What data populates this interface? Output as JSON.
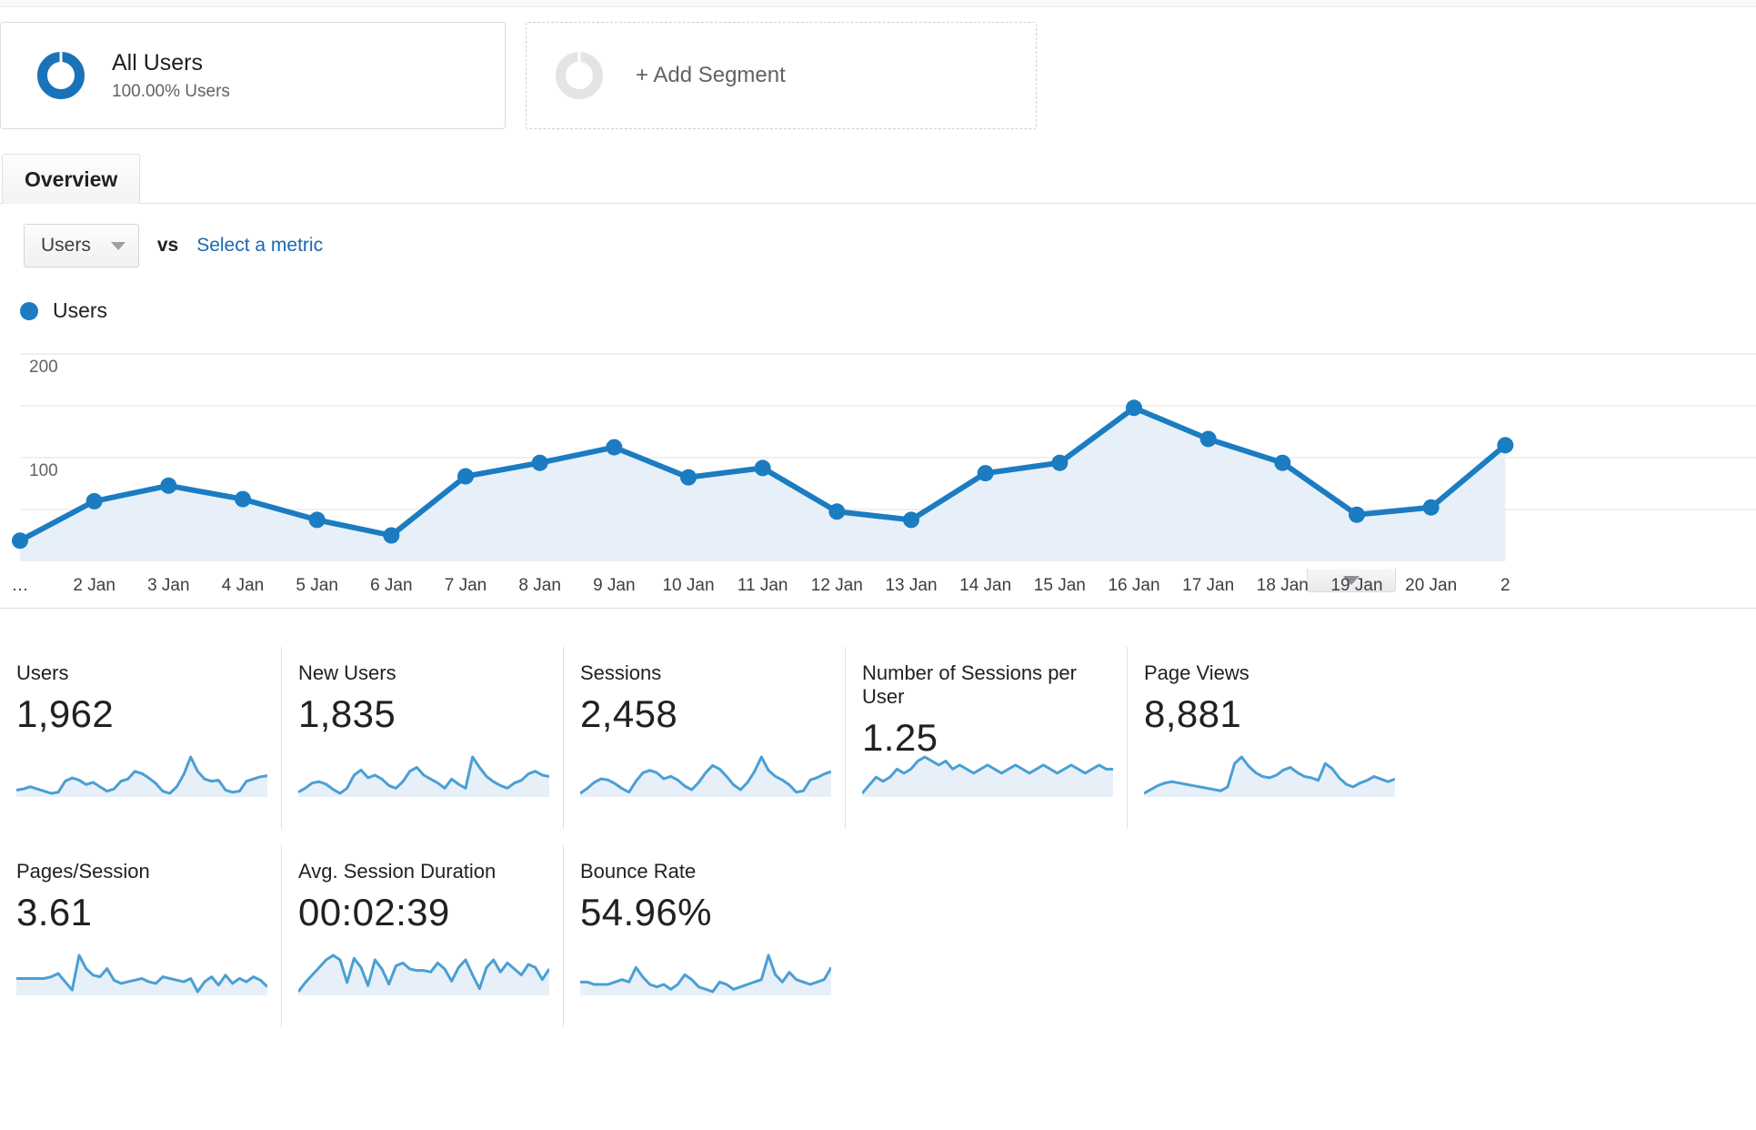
{
  "segment_bar": {
    "all_users": {
      "title": "All Users",
      "subtitle": "100.00% Users",
      "icon": "donut-icon"
    },
    "add_segment": {
      "label": "+ Add Segment",
      "icon": "donut-placeholder-icon"
    }
  },
  "tabs": [
    {
      "label": "Overview",
      "active": true
    }
  ],
  "metric_selector": {
    "selected_metric": "Users",
    "vs_label": "vs",
    "select_metric_link": "Select a metric",
    "caret_icon": "chevron-down-icon"
  },
  "legend": [
    {
      "label": "Users",
      "color": "#1b7cc1"
    }
  ],
  "chart_controls": {
    "collapse_icon": "chevron-down-icon"
  },
  "chart_data": {
    "type": "area",
    "title": "Users",
    "xlabel": "",
    "ylabel": "Users",
    "ylim": [
      0,
      200
    ],
    "yticks": [
      100,
      200
    ],
    "ytick_labels": [
      "100",
      "200"
    ],
    "gridlines": [
      50,
      100,
      150,
      200
    ],
    "grid": true,
    "legend_position": "top-left",
    "line_color": "#1b7cc1",
    "fill_color": "#e7f0f8",
    "marker": "circle",
    "categories": [
      "…",
      "2 Jan",
      "3 Jan",
      "4 Jan",
      "5 Jan",
      "6 Jan",
      "7 Jan",
      "8 Jan",
      "9 Jan",
      "10 Jan",
      "11 Jan",
      "12 Jan",
      "13 Jan",
      "14 Jan",
      "15 Jan",
      "16 Jan",
      "17 Jan",
      "18 Jan",
      "19 Jan",
      "20 Jan",
      "2"
    ],
    "series": [
      {
        "name": "Users",
        "values": [
          20,
          58,
          73,
          60,
          40,
          25,
          82,
          95,
          110,
          81,
          90,
          48,
          40,
          85,
          95,
          148,
          118,
          95,
          45,
          52,
          112
        ]
      }
    ]
  },
  "metric_cards_row1": [
    {
      "title": "Users",
      "value": "1,962",
      "spark": [
        28,
        30,
        34,
        30,
        26,
        22,
        24,
        44,
        50,
        46,
        38,
        42,
        34,
        26,
        30,
        44,
        48,
        62,
        58,
        50,
        40,
        26,
        22,
        34,
        56,
        88,
        62,
        48,
        44,
        46,
        28,
        24,
        26,
        44,
        48,
        52,
        54
      ]
    },
    {
      "title": "New Users",
      "value": "1,835",
      "spark": [
        24,
        30,
        38,
        40,
        36,
        28,
        22,
        30,
        50,
        58,
        46,
        50,
        44,
        34,
        30,
        40,
        56,
        62,
        50,
        44,
        38,
        30,
        44,
        36,
        30,
        78,
        62,
        48,
        40,
        34,
        30,
        38,
        42,
        52,
        56,
        50,
        48
      ]
    },
    {
      "title": "Sessions",
      "value": "2,458",
      "spark": [
        22,
        30,
        40,
        46,
        44,
        38,
        30,
        24,
        42,
        56,
        60,
        56,
        46,
        50,
        44,
        34,
        28,
        40,
        56,
        68,
        62,
        50,
        36,
        28,
        40,
        58,
        82,
        60,
        50,
        44,
        36,
        24,
        26,
        44,
        48,
        54,
        58
      ]
    },
    {
      "title": "Number of Sessions per User",
      "value": "1.25",
      "spark": [
        54,
        56,
        58,
        57,
        58,
        60,
        59,
        60,
        62,
        63,
        62,
        61,
        62,
        60,
        61,
        60,
        59,
        60,
        61,
        60,
        59,
        60,
        61,
        60,
        59,
        60,
        61,
        60,
        59,
        60,
        61,
        60,
        59,
        60,
        61,
        60,
        60
      ]
    },
    {
      "title": "Page Views",
      "value": "8,881",
      "spark": [
        20,
        26,
        32,
        36,
        38,
        36,
        34,
        32,
        30,
        28,
        26,
        24,
        30,
        66,
        76,
        62,
        52,
        46,
        44,
        48,
        56,
        60,
        52,
        46,
        44,
        40,
        66,
        58,
        44,
        34,
        30,
        36,
        40,
        46,
        42,
        38,
        42
      ]
    }
  ],
  "metric_cards_row2": [
    {
      "title": "Pages/Session",
      "value": "3.61",
      "spark": [
        34,
        34,
        34,
        34,
        34,
        36,
        40,
        30,
        20,
        62,
        46,
        38,
        36,
        46,
        32,
        28,
        30,
        32,
        34,
        30,
        28,
        36,
        34,
        32,
        30,
        34,
        18,
        30,
        36,
        26,
        38,
        28,
        34,
        30,
        36,
        32,
        24
      ]
    },
    {
      "title": "Avg. Session Duration",
      "value": "00:02:39",
      "spark": [
        14,
        26,
        36,
        46,
        56,
        62,
        56,
        26,
        58,
        46,
        22,
        56,
        44,
        24,
        48,
        52,
        44,
        42,
        42,
        40,
        52,
        44,
        28,
        46,
        56,
        36,
        18,
        46,
        56,
        40,
        52,
        44,
        36,
        50,
        46,
        30,
        44
      ]
    },
    {
      "title": "Bounce Rate",
      "value": "54.96%",
      "spark": [
        44,
        44,
        42,
        42,
        42,
        44,
        46,
        44,
        56,
        48,
        42,
        40,
        42,
        38,
        42,
        50,
        46,
        40,
        38,
        36,
        44,
        42,
        38,
        40,
        42,
        44,
        46,
        66,
        50,
        44,
        52,
        46,
        44,
        42,
        44,
        46,
        56
      ]
    }
  ]
}
